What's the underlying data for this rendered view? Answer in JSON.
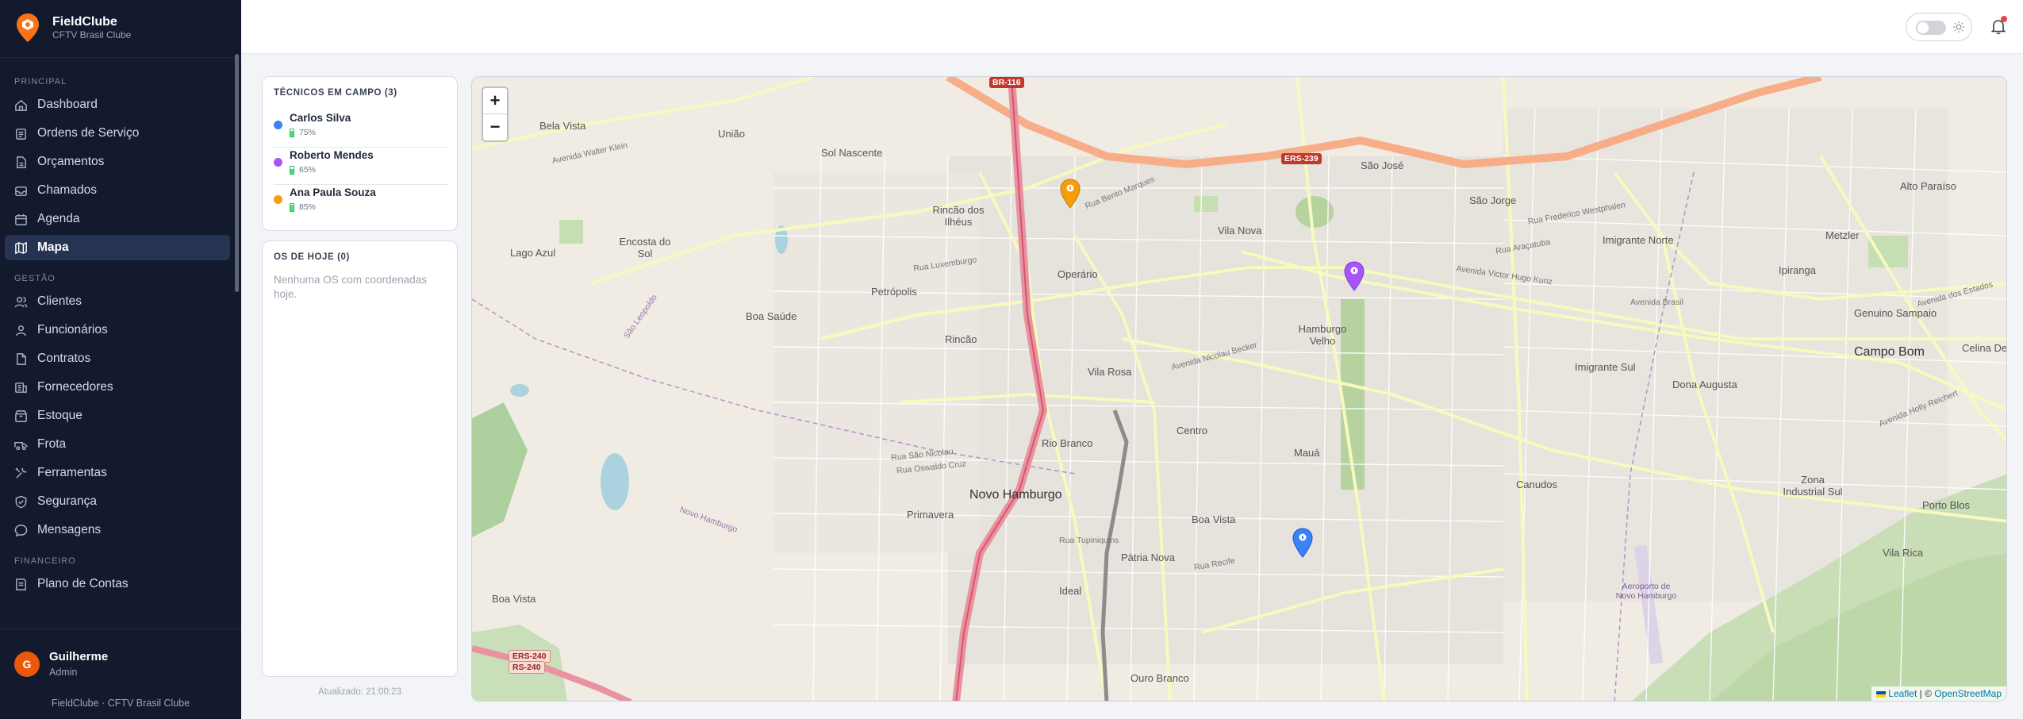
{
  "brand": {
    "name": "FieldClube",
    "subtitle": "CFTV Brasil Clube"
  },
  "sidebar": {
    "sections": [
      {
        "label": "PRINCIPAL"
      },
      {
        "label": "GESTÃO"
      },
      {
        "label": "FINANCEIRO"
      }
    ],
    "items": [
      {
        "label": "Dashboard",
        "icon": "dashboard-icon"
      },
      {
        "label": "Ordens de Serviço",
        "icon": "clipboard-icon"
      },
      {
        "label": "Orçamentos",
        "icon": "file-icon"
      },
      {
        "label": "Chamados",
        "icon": "inbox-icon"
      },
      {
        "label": "Agenda",
        "icon": "calendar-icon"
      },
      {
        "label": "Mapa",
        "icon": "map-icon",
        "active": true
      },
      {
        "label": "Clientes",
        "icon": "users-icon"
      },
      {
        "label": "Funcionários",
        "icon": "team-icon"
      },
      {
        "label": "Contratos",
        "icon": "document-icon"
      },
      {
        "label": "Fornecedores",
        "icon": "truck-icon"
      },
      {
        "label": "Estoque",
        "icon": "box-icon"
      },
      {
        "label": "Frota",
        "icon": "vehicle-icon"
      },
      {
        "label": "Ferramentas",
        "icon": "tools-icon"
      },
      {
        "label": "Segurança",
        "icon": "shield-icon"
      },
      {
        "label": "Mensagens",
        "icon": "chat-icon"
      },
      {
        "label": "Plano de Contas",
        "icon": "ledger-icon"
      }
    ],
    "user": {
      "initial": "G",
      "name": "Guilherme",
      "role": "Admin"
    },
    "footer": "FieldClube · CFTV Brasil Clube"
  },
  "header": {
    "theme_toggle": "theme-toggle",
    "notifications": "bell-icon"
  },
  "technicians": {
    "title": "TÉCNICOS EM CAMPO (3)",
    "items": [
      {
        "name": "Carlos Silva",
        "battery": "75%",
        "battery_level": 0.75,
        "color": "#3b82f6"
      },
      {
        "name": "Roberto Mendes",
        "battery": "65%",
        "battery_level": 0.65,
        "color": "#a855f7"
      },
      {
        "name": "Ana Paula Souza",
        "battery": "85%",
        "battery_level": 0.85,
        "color": "#f59e0b"
      }
    ]
  },
  "os_today": {
    "title": "OS DE HOJE (0)",
    "empty": "Nenhuma OS com coordenadas hoje."
  },
  "updated": "Atualizado: 21:00:23",
  "map": {
    "zoom_in": "+",
    "zoom_out": "−",
    "attribution_leaflet": "Leaflet",
    "attribution_sep": "| ©",
    "attribution_osm": "OpenStreetMap",
    "labels": {
      "bela_vista": "Bela Vista",
      "uniao": "União",
      "sol_nascente": "Sol Nascente",
      "rincao_ilheus": "Rincão dos Ilhéus",
      "lago_azul": "Lago Azul",
      "encosta_sol": "Encosta do Sol",
      "boa_saude": "Boa Saúde",
      "petropolis": "Petrópolis",
      "rincao": "Rincão",
      "operario": "Operário",
      "vila_nova": "Vila Nova",
      "sao_jose": "São José",
      "sao_jorge": "São Jorge",
      "imigrante_norte": "Imigrante Norte",
      "metzler": "Metzler",
      "alto_paraiso": "Alto Paraíso",
      "ipiranga": "Ipiranga",
      "genuino_sampaio": "Genuino Sampaio",
      "campo_bom": "Campo Bom",
      "celina": "Celina De",
      "hamburgo_velho": "Hamburgo Velho",
      "vila_rosa": "Vila Rosa",
      "centro": "Centro",
      "imigrante_sul": "Imigrante Sul",
      "dona_augusta": "Dona Augusta",
      "rio_branco": "Rio Branco",
      "maua": "Mauá",
      "novo_hamburgo": "Novo Hamburgo",
      "primavera": "Primavera",
      "canudos": "Canudos",
      "zona_industrial": "Zona Industrial Sul",
      "porto_blos": "Porto Blos",
      "boa_vista": "Boa Vista",
      "patria_nova": "Pátria Nova",
      "vila_rica": "Vila Rica",
      "ideal": "Ideal",
      "boa_vista_sw": "Boa Vista",
      "ouro_branco": "Ouro Branco",
      "aeroporto": "Aeroporto de Novo Hamburgo",
      "sao_leopoldo": "São Leopoldo",
      "novo_hamburgo_lim": "Novo Hamburgo",
      "av_brasil": "Avenida Brasil",
      "av_victor": "Avenida Victor Hugo Kunz",
      "av_nicolau": "Avenida Nicolau Becker",
      "rua_bento": "Rua Bento Marques",
      "rua_luxemburgo": "Rua Luxemburgo",
      "rua_recife": "Rua Recife",
      "rua_tupiniquins": "Rua Tupiniquins",
      "rua_sao_nicolau": "Rua São Nicolau",
      "rua_oswaldo": "Rua Oswaldo Cruz",
      "av_walter": "Avenida Walter Klein",
      "av_estados": "Avenida dos Estados",
      "rua_fred": "Rua Frederico Westphalen",
      "rua_araçatuba": "Rua Araçatuba",
      "av_holly": "Avenida Holly Reichert"
    },
    "shields": {
      "br116": "BR-116",
      "ers239": "ERS-239",
      "ers240": "ERS-240",
      "rs240": "RS-240"
    },
    "pins": [
      {
        "technician": "Ana Paula Souza",
        "color": "#f59e0b"
      },
      {
        "technician": "Roberto Mendes",
        "color": "#a855f7"
      },
      {
        "technician": "Carlos Silva",
        "color": "#3b82f6"
      }
    ]
  }
}
